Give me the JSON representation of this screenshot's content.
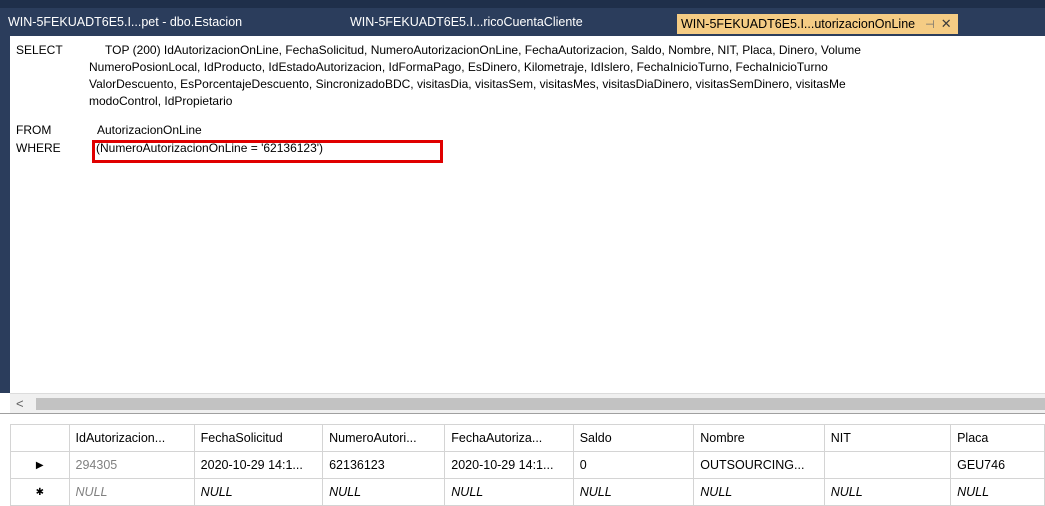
{
  "tabs": [
    {
      "label": "WIN-5FEKUADT6E5.I...pet - dbo.Estacion"
    },
    {
      "label": "WIN-5FEKUADT6E5.I...ricoCuentaCliente"
    },
    {
      "label": "WIN-5FEKUADT6E5.I...utorizacionOnLine",
      "pin": "⊣",
      "close": "✕"
    }
  ],
  "sql": {
    "select_kw": "SELECT",
    "select_line1": "TOP (200) IdAutorizacionOnLine, FechaSolicitud, NumeroAutorizacionOnLine, FechaAutorizacion, Saldo, Nombre, NIT, Placa, Dinero, Volume",
    "select_line2": "NumeroPosionLocal, IdProducto, IdEstadoAutorizacion, IdFormaPago, EsDinero, Kilometraje, IdIslero, FechaInicioTurno, FechaInicioTurno",
    "select_line3": "ValorDescuento, EsPorcentajeDescuento, SincronizadoBDC, visitasDia, visitasSem, visitasMes, visitasDiaDinero, visitasSemDinero, visitasMe",
    "select_line4": "modoControl, IdPropietario",
    "from_kw": "FROM",
    "from_text": "AutorizacionOnLine",
    "where_kw": "WHERE",
    "where_text": "(NumeroAutorizacionOnLine = '62136123')"
  },
  "grid": {
    "columns": [
      "IdAutorizacion...",
      "FechaSolicitud",
      "NumeroAutori...",
      "FechaAutoriza...",
      "Saldo",
      "Nombre",
      "NIT",
      "Placa"
    ],
    "rows": [
      {
        "marker": "▶",
        "cells": [
          "294305",
          "2020-10-29 14:1...",
          "62136123",
          "2020-10-29 14:1...",
          "0",
          "OUTSOURCING...",
          "",
          "GEU746"
        ]
      },
      {
        "marker": "✱",
        "cells": [
          "NULL",
          "NULL",
          "NULL",
          "NULL",
          "NULL",
          "NULL",
          "NULL",
          "NULL"
        ]
      }
    ]
  },
  "scroll": {
    "left_arrow": "<"
  }
}
